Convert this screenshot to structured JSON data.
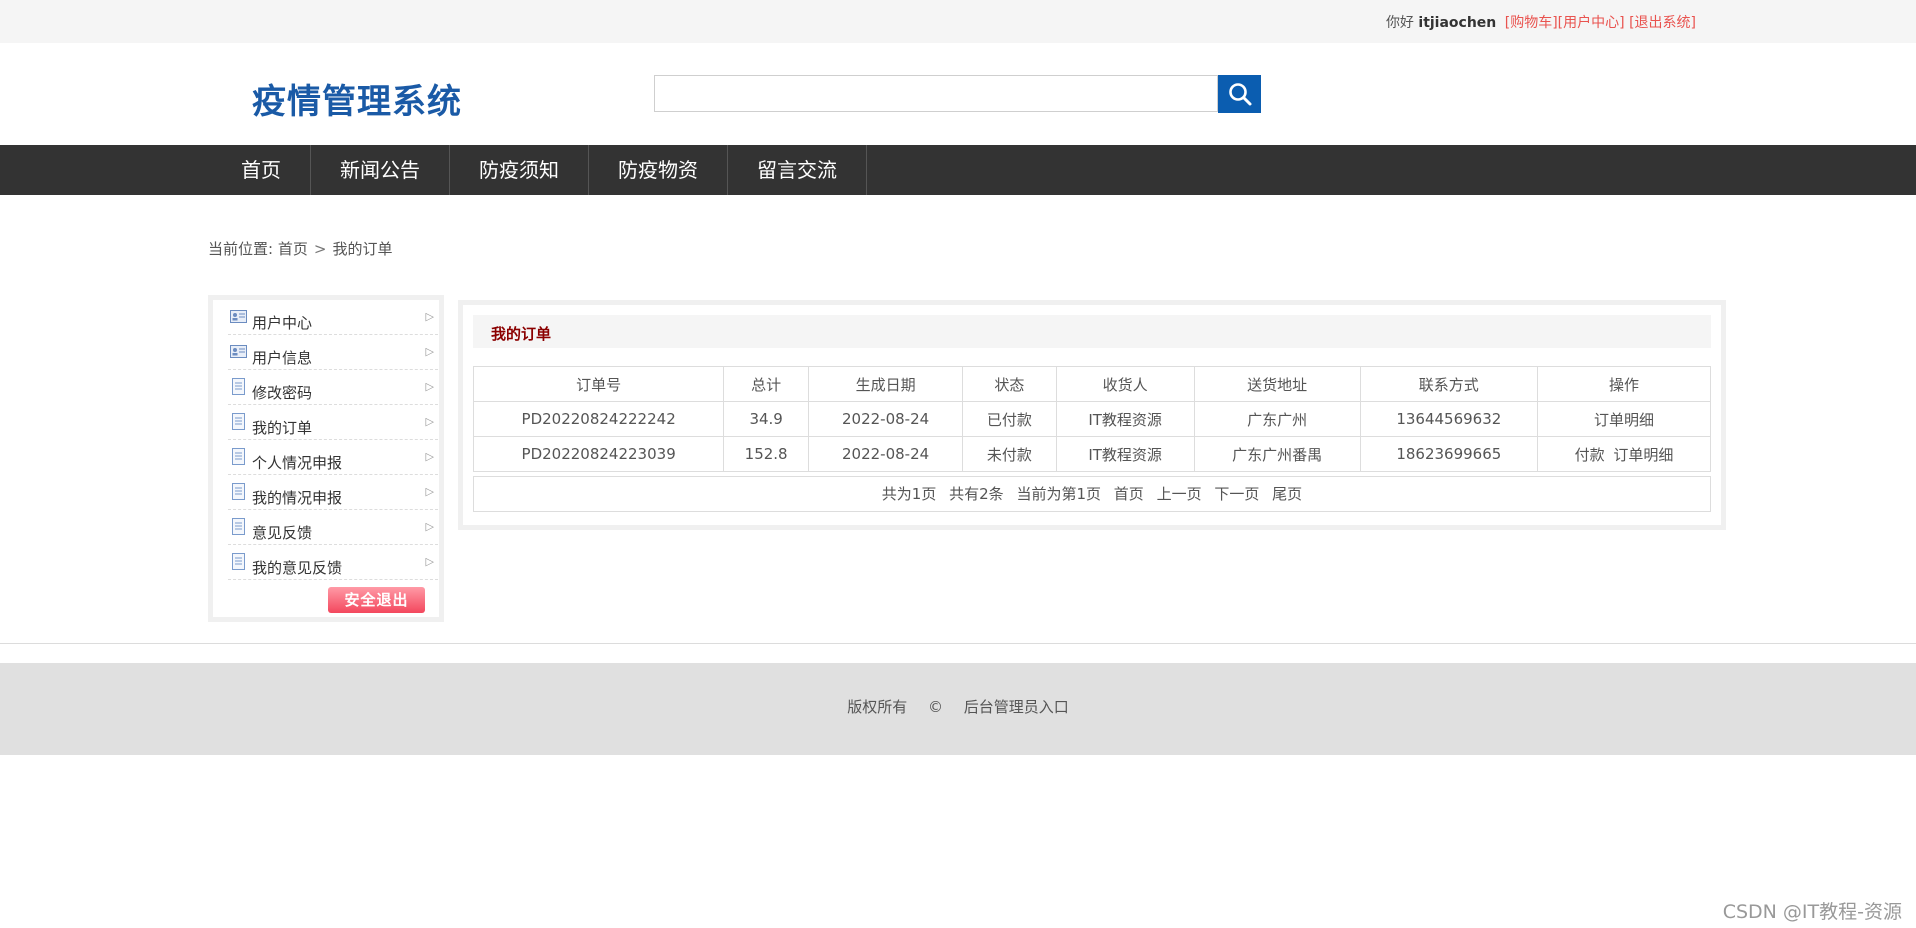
{
  "topbar": {
    "greeting": "你好",
    "username": "itjiaochen",
    "cart_link": "[购物车]",
    "user_center_link": "[用户中心]",
    "logout_link": "[退出系统]",
    "link_color": "#e9534f"
  },
  "header": {
    "logo_text": "疫情管理系统",
    "logo_color": "#1a5aa6",
    "search": {
      "value": "",
      "button_icon": "search-icon",
      "button_color": "#0b5db0"
    }
  },
  "nav": {
    "items": [
      {
        "label": "首页"
      },
      {
        "label": "新闻公告"
      },
      {
        "label": "防疫须知"
      },
      {
        "label": "防疫物资"
      },
      {
        "label": "留言交流"
      }
    ]
  },
  "breadcrumb": {
    "prefix": "当前位置:",
    "home": "首页",
    "separator": ">",
    "current": "我的订单"
  },
  "sidebar": {
    "items": [
      {
        "label": "用户中心",
        "icon": "id-card-icon"
      },
      {
        "label": "用户信息",
        "icon": "id-card-icon"
      },
      {
        "label": "修改密码",
        "icon": "document-icon"
      },
      {
        "label": "我的订单",
        "icon": "document-icon"
      },
      {
        "label": "个人情况申报",
        "icon": "document-icon"
      },
      {
        "label": "我的情况申报",
        "icon": "document-icon"
      },
      {
        "label": "意见反馈",
        "icon": "document-icon"
      },
      {
        "label": "我的意见反馈",
        "icon": "document-icon"
      }
    ],
    "logout_button": "安全退出"
  },
  "orders": {
    "title": "我的订单",
    "columns": [
      "订单号",
      "总计",
      "生成日期",
      "状态",
      "收货人",
      "送货地址",
      "联系方式",
      "操作"
    ],
    "rows": [
      {
        "order_no": "PD20220824222242",
        "total": "34.9",
        "date": "2022-08-24",
        "status": "已付款",
        "receiver": "IT教程资源",
        "address": "广东广州",
        "phone": "13644569632",
        "pay": "",
        "detail": "订单明细"
      },
      {
        "order_no": "PD20220824223039",
        "total": "152.8",
        "date": "2022-08-24",
        "status": "未付款",
        "receiver": "IT教程资源",
        "address": "广东广州番禺",
        "phone": "18623699665",
        "pay": "付款",
        "detail": "订单明细"
      }
    ]
  },
  "pager": {
    "total_pages": "共为1页",
    "total_items": "共有2条",
    "current_page": "当前为第1页",
    "first": "首页",
    "prev": "上一页",
    "next": "下一页",
    "last": "尾页"
  },
  "footer": {
    "copyright": "版权所有",
    "copy_symbol": "©",
    "admin_link": "后台管理员入口"
  },
  "watermark": "CSDN @IT教程-资源"
}
